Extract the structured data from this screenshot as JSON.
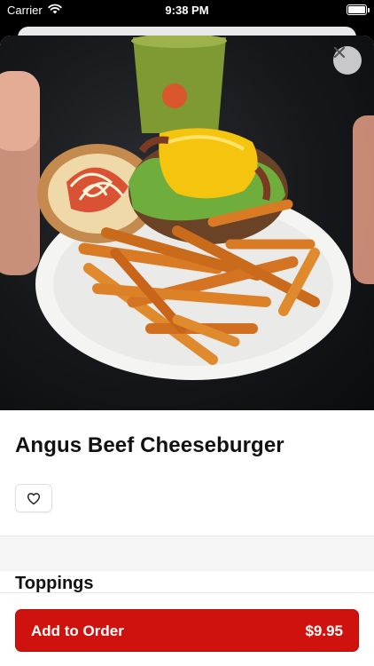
{
  "status_bar": {
    "carrier": "Carrier",
    "time": "9:38 PM",
    "wifi_icon": "wifi-icon",
    "battery_icon": "battery-full-icon"
  },
  "item": {
    "name": "Angus Beef Cheeseburger",
    "image_alt": "Angus Beef Cheeseburger with sweet potato fries",
    "close_icon": "close-icon",
    "favorite_icon": "heart-outline-icon"
  },
  "sections": [
    {
      "title": "Toppings"
    }
  ],
  "footer": {
    "button_label": "Add to Order",
    "price": "$9.95",
    "accent_color": "#d0120f"
  }
}
